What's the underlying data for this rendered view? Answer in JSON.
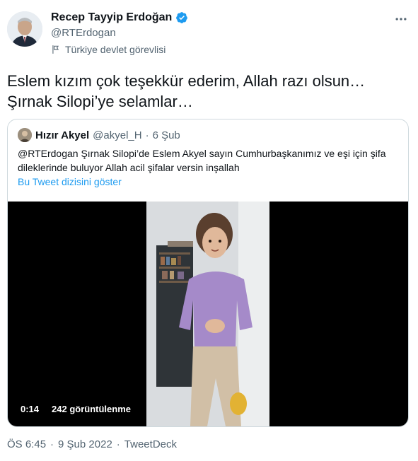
{
  "author": {
    "name": "Recep Tayyip Erdoğan",
    "handle": "@RTErdogan",
    "affiliation": "Türkiye devlet görevlisi"
  },
  "tweet": {
    "text": "Eslem kızım çok teşekkür ederim, Allah razı olsun…\nŞırnak Silopi’ye selamlar…"
  },
  "quoted": {
    "name": "Hızır Akyel",
    "handle": "@akyel_H",
    "separator": "·",
    "date": "6 Şub",
    "text": "@RTErdogan Şırnak Silopi’de Eslem Akyel sayın Cumhurbaşkanımız ve eşi için şifa dileklerinde buluyor Allah acil şifalar versin inşallah",
    "thread_link": "Bu Tweet dizisini göster",
    "video": {
      "duration": "0:14",
      "views": "242 görüntülenme"
    }
  },
  "meta": {
    "time": "ÖS 6:45",
    "separator1": "·",
    "date": "9 Şub 2022",
    "separator2": "·",
    "source": "TweetDeck"
  },
  "colors": {
    "accent": "#1d9bf0",
    "secondary_text": "#536471",
    "border": "#cfd9de"
  },
  "icons": [
    "verified-badge-icon",
    "more-options-icon",
    "flag-icon"
  ]
}
